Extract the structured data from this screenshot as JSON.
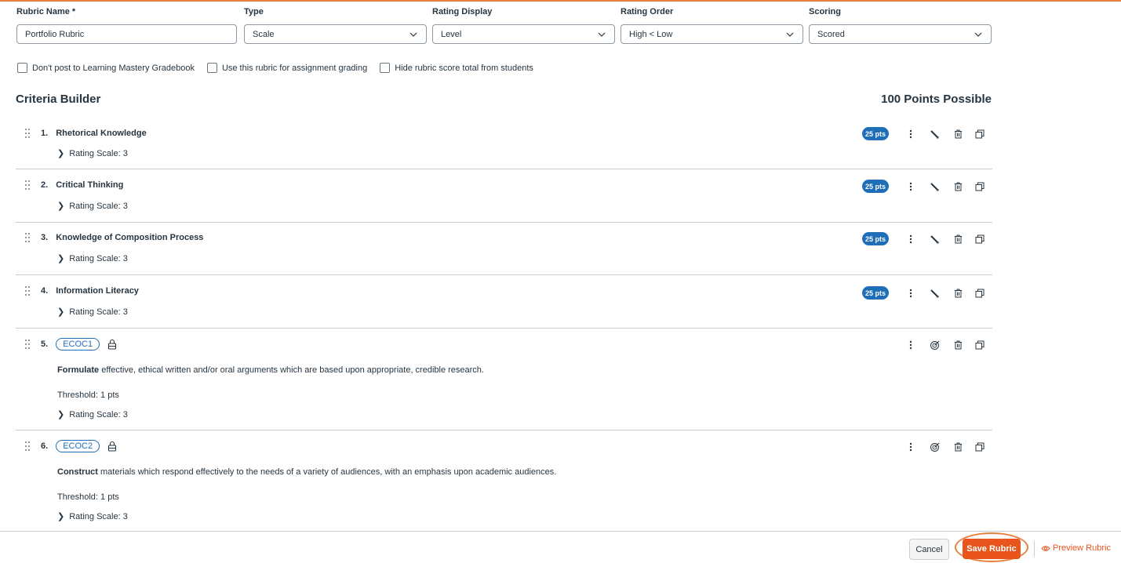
{
  "form": {
    "name_label": "Rubric Name *",
    "name_value": "Portfolio Rubric",
    "type_label": "Type",
    "type_value": "Scale",
    "rating_display_label": "Rating Display",
    "rating_display_value": "Level",
    "rating_order_label": "Rating Order",
    "rating_order_value": "High < Low",
    "scoring_label": "Scoring",
    "scoring_value": "Scored"
  },
  "options": {
    "no_lmgb": "Don't post to Learning Mastery Gradebook",
    "use_for_grading": "Use this rubric for assignment grading",
    "hide_total": "Hide rubric score total from students"
  },
  "builder": {
    "title": "Criteria Builder",
    "points_possible": "100 Points Possible"
  },
  "criteria": [
    {
      "num": "1.",
      "title": "Rhetorical Knowledge",
      "points": "25 pts",
      "rating_scale": "Rating Scale: 3"
    },
    {
      "num": "2.",
      "title": "Critical Thinking",
      "points": "25 pts",
      "rating_scale": "Rating Scale: 3"
    },
    {
      "num": "3.",
      "title": "Knowledge of Composition Process",
      "points": "25 pts",
      "rating_scale": "Rating Scale: 3"
    },
    {
      "num": "4.",
      "title": "Information Literacy",
      "points": "25 pts",
      "rating_scale": "Rating Scale: 3"
    },
    {
      "num": "5.",
      "outcome": "ECOC1",
      "desc_bold": "Formulate",
      "desc_rest": " effective, ethical written and/or oral arguments which are based upon appropriate, credible research.",
      "threshold": "Threshold: 1 pts",
      "rating_scale": "Rating Scale: 3"
    },
    {
      "num": "6.",
      "outcome": "ECOC2",
      "desc_bold": "Construct",
      "desc_rest": " materials which respond effectively to the needs of a variety of audiences, with an emphasis upon academic audiences.",
      "threshold": "Threshold: 1 pts",
      "rating_scale": "Rating Scale: 3"
    }
  ],
  "footer": {
    "cancel": "Cancel",
    "save": "Save Rubric",
    "preview": "Preview Rubric"
  },
  "colors": {
    "accent": "#e8541c",
    "pill": "#1e6fb8"
  }
}
